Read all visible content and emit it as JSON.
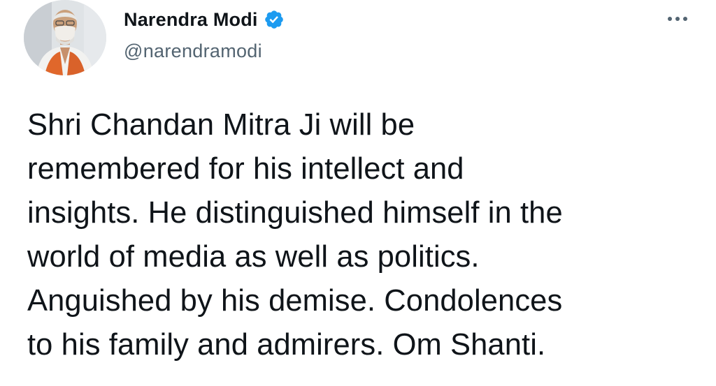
{
  "author": {
    "display_name": "Narendra Modi",
    "handle": "@narendramodi",
    "verified": true,
    "avatar_icon": "profile-photo"
  },
  "menu": {
    "icon": "more-horizontal-icon"
  },
  "tweet": {
    "lines": [
      "Shri Chandan Mitra Ji will be",
      "remembered for his intellect and",
      "insights. He distinguished himself in the",
      "world of media as well as politics.",
      "Anguished by his demise. Condolences",
      "to his family and admirers. Om Shanti."
    ]
  },
  "colors": {
    "text": "#0f1419",
    "secondary": "#536471",
    "verified_blue": "#1d9bf0"
  }
}
